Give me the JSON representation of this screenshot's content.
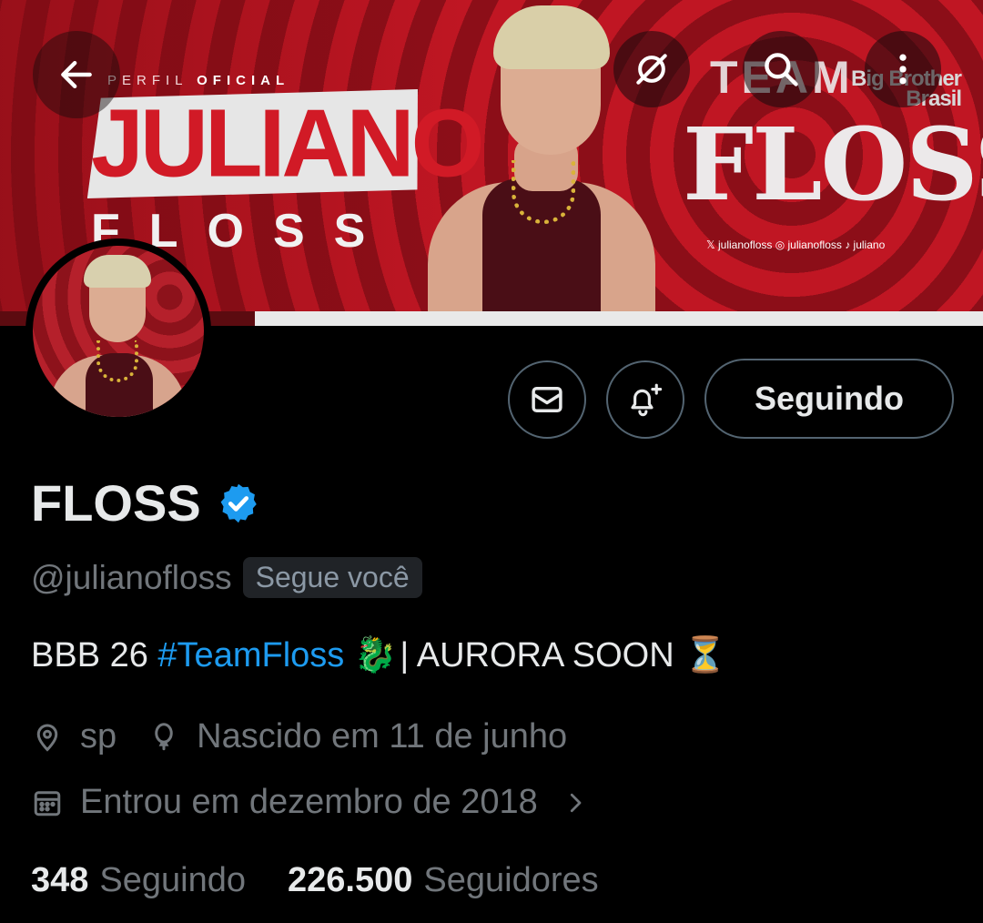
{
  "banner": {
    "perfil_label": "PERFIL",
    "oficial_label": "OFICIAL",
    "name_big": "JULIANO",
    "name_sub": "FLOSS",
    "team_label": "TEAM",
    "floss_logo": "FLOSS",
    "socials": "𝕏 julianofloss  ◎ julianofloss  ♪ juliano",
    "bbb_logo": "Big Brother Brasil"
  },
  "toolbar": {
    "back_icon": "arrow-left-icon",
    "grok_icon": "grok-icon",
    "search_icon": "search-icon",
    "more_icon": "more-vertical-icon"
  },
  "actions": {
    "message_icon": "envelope-icon",
    "notify_icon": "bell-plus-icon",
    "follow_label": "Seguindo"
  },
  "profile": {
    "display_name": "FLOSS",
    "verified": true,
    "handle": "@julianofloss",
    "follows_you": "Segue você",
    "bio_prefix": "BBB 26 ",
    "bio_hashtag": "#TeamFloss",
    "bio_emoji1": "🐉",
    "bio_suffix": " | AURORA SOON ",
    "bio_emoji2": "⏳",
    "location": "sp",
    "birthday": "Nascido em 11 de junho",
    "joined": "Entrou em dezembro de 2018"
  },
  "stats": {
    "following_count": "348",
    "following_label": "Seguindo",
    "followers_count": "226.500",
    "followers_label": "Seguidores"
  },
  "colors": {
    "accent": "#1d9bf0",
    "muted": "#71767b",
    "text": "#e7e9ea",
    "background": "#000000",
    "banner_red": "#c01623"
  }
}
